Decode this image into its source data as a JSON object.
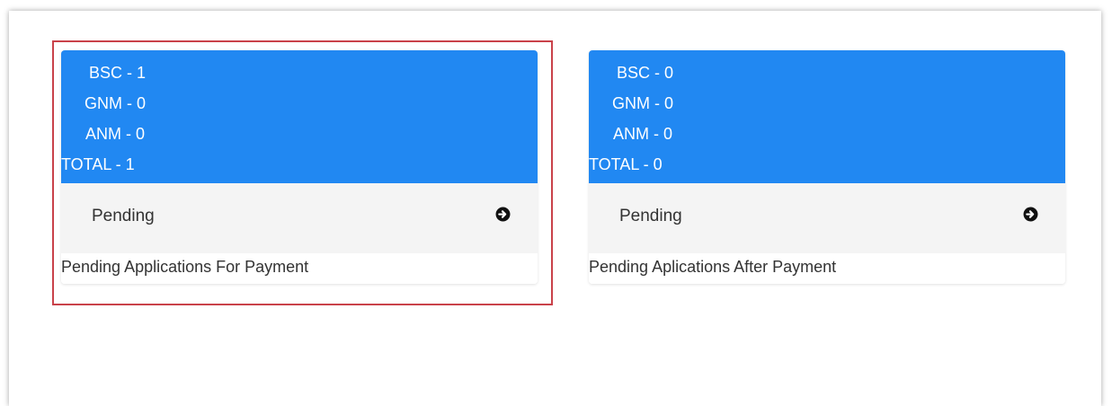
{
  "cards": [
    {
      "stats": [
        "BSC - 1",
        "GNM - 0",
        "ANM - 0",
        "TOTAL - 1"
      ],
      "footer_label": "Pending",
      "footer_icon": "arrow-circle-right-icon",
      "caption": "Pending Applications For Payment",
      "highlighted": true
    },
    {
      "stats": [
        "BSC - 0",
        "GNM - 0",
        "ANM - 0",
        "TOTAL - 0"
      ],
      "footer_label": "Pending",
      "footer_icon": "arrow-circle-right-icon",
      "caption": "Pending Aplications After Payment",
      "highlighted": false
    }
  ],
  "colors": {
    "header_blue": "#2188f2",
    "highlight_border": "#c9424a",
    "footer_bg": "#f4f4f4"
  }
}
